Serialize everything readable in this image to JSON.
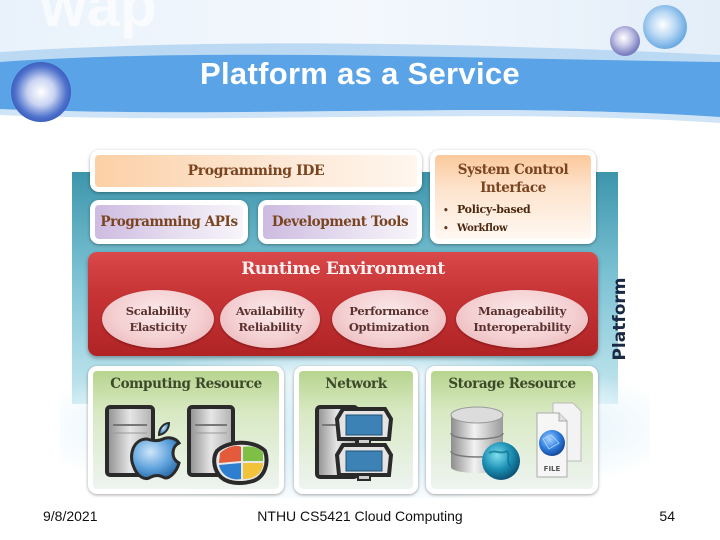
{
  "slide": {
    "title": "Platform as a Service"
  },
  "diagram": {
    "programming_ide": "Programming IDE",
    "programming_apis": "Programming APIs",
    "development_tools": "Development Tools",
    "system_control": {
      "title_line1": "System Control",
      "title_line2": "Interface",
      "bullets": [
        "Policy-based",
        "Workflow"
      ]
    },
    "runtime": {
      "title": "Runtime Environment",
      "qualities": [
        {
          "line1": "Scalability",
          "line2": "Elasticity"
        },
        {
          "line1": "Availability",
          "line2": "Reliability"
        },
        {
          "line1": "Performance",
          "line2": "Optimization"
        },
        {
          "line1": "Manageability",
          "line2": "Interoperability"
        }
      ]
    },
    "side_label": "Platform",
    "resources": [
      {
        "title": "Computing Resource",
        "icons": [
          "server-icon",
          "apple-logo-icon",
          "server-icon",
          "windows-logo-icon"
        ]
      },
      {
        "title": "Network",
        "icons": [
          "server-icon",
          "monitor-icon",
          "monitor-icon"
        ]
      },
      {
        "title": "Storage Resource",
        "icons": [
          "database-icon",
          "globe-icon",
          "file-icon"
        ],
        "file_label": "FILE"
      }
    ],
    "colors": {
      "runtime_red": "#c73436",
      "label_brown": "#7a4420",
      "teal": "#3d95ab",
      "banner_blue": "#5aa3e6"
    }
  },
  "footer": {
    "date": "9/8/2021",
    "course": "NTHU CS5421 Cloud Computing",
    "page": "54"
  }
}
